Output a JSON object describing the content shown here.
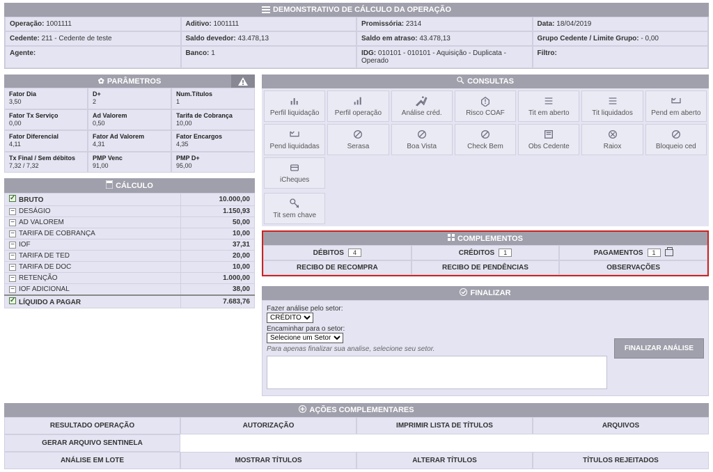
{
  "header": {
    "title": "DEMONSTRATIVO DE CÁLCULO DA OPERAÇÃO"
  },
  "info": {
    "operacao_l": "Operação:",
    "operacao_v": "1001111",
    "aditivo_l": "Aditivo:",
    "aditivo_v": "1001111",
    "promissoria_l": "Promissória:",
    "promissoria_v": "2314",
    "data_l": "Data:",
    "data_v": "18/04/2019",
    "cedente_l": "Cedente:",
    "cedente_v": "211 - Cedente de teste",
    "saldo_dev_l": "Saldo devedor:",
    "saldo_dev_v": "43.478,13",
    "saldo_atr_l": "Saldo em atraso:",
    "saldo_atr_v": "43.478,13",
    "grupo_l": "Grupo Cedente / Limite Grupo:",
    "grupo_v": "- 0,00",
    "agente_l": "Agente:",
    "agente_v": "",
    "banco_l": "Banco:",
    "banco_v": "1",
    "idg_l": "IDG:",
    "idg_v": "010101 - 010101 - Aquisição - Duplicata - Operado",
    "filtro_l": "Filtro:",
    "filtro_v": ""
  },
  "parametros": {
    "title": "PARÂMETROS",
    "cells": [
      {
        "l": "Fator Dia",
        "v": "3,50"
      },
      {
        "l": "D+",
        "v": "2"
      },
      {
        "l": "Num.Títulos",
        "v": "1"
      },
      {
        "l": "Fator Tx Serviço",
        "v": "0,00"
      },
      {
        "l": "Ad Valorem",
        "v": "0,50"
      },
      {
        "l": "Tarifa de Cobrança",
        "v": "10,00"
      },
      {
        "l": "Fator Diferencial",
        "v": "4,11"
      },
      {
        "l": "Fator Ad Valorem",
        "v": "4,31"
      },
      {
        "l": "Fator Encargos",
        "v": "4,35"
      },
      {
        "l": "Tx Final / Sem débitos",
        "v": "7,32 / 7,32"
      },
      {
        "l": "PMP Venc",
        "v": "91,00"
      },
      {
        "l": "PMP D+",
        "v": "95,00"
      }
    ]
  },
  "calculo": {
    "title": "CÁLCULO",
    "bruto_l": "BRUTO",
    "bruto_v": "10.000,00",
    "liquido_l": "LÍQUIDO A PAGAR",
    "liquido_v": "7.683,76",
    "rows": [
      {
        "l": "DESÁGIO",
        "v": "1.150,93"
      },
      {
        "l": "AD VALOREM",
        "v": "50,00"
      },
      {
        "l": "TARIFA DE COBRANÇA",
        "v": "10,00"
      },
      {
        "l": "IOF",
        "v": "37,31"
      },
      {
        "l": "TARIFA DE TED",
        "v": "20,00"
      },
      {
        "l": "TARIFA DE DOC",
        "v": "10,00"
      },
      {
        "l": "RETENÇÃO",
        "v": "1.000,00"
      },
      {
        "l": "IOF ADICIONAL",
        "v": "38,00"
      }
    ]
  },
  "consultas": {
    "title": "CONSULTAS",
    "items": [
      "Perfil liquidação",
      "Perfil operação",
      "Análise créd.",
      "Risco COAF",
      "Tit em aberto",
      "Tit liquidados",
      "Pend em aberto",
      "Pend liquidadas",
      "Serasa",
      "Boa Vista",
      "Check Bem",
      "Obs Cedente",
      "Raiox",
      "Bloqueio ced",
      "iCheques"
    ],
    "extra": "Tit sem chave"
  },
  "complementos": {
    "title": "COMPLEMENTOS",
    "row1": [
      {
        "l": "DÉBITOS",
        "b": "4"
      },
      {
        "l": "CRÉDITOS",
        "b": "1"
      },
      {
        "l": "PAGAMENTOS",
        "b": "1"
      }
    ],
    "row2": [
      "RECIBO DE RECOMPRA",
      "RECIBO DE PENDÊNCIAS",
      "OBSERVAÇÕES"
    ]
  },
  "finalizar": {
    "title": "FINALIZAR",
    "fazer_l": "Fazer análise pelo setor:",
    "fazer_sel": "CRÉDITO",
    "encaminhar_l": "Encaminhar para o setor:",
    "encaminhar_sel": "Selecione um Setor",
    "hint": "Para apenas finalizar sua analise, selecione seu setor.",
    "btn": "FINALIZAR ANÁLISE"
  },
  "acoes": {
    "title": "AÇÕES COMPLEMENTARES",
    "row1": [
      "RESULTADO OPERAÇÃO",
      "AUTORIZAÇÃO",
      "IMPRIMIR LISTA DE TÍTULOS",
      "ARQUIVOS"
    ],
    "row2l": "GERAR ARQUIVO SENTINELA",
    "row3": [
      "ANÁLISE EM LOTE",
      "MOSTRAR TÍTULOS",
      "ALTERAR TÍTULOS",
      "TÍTULOS REJEITADOS"
    ]
  }
}
